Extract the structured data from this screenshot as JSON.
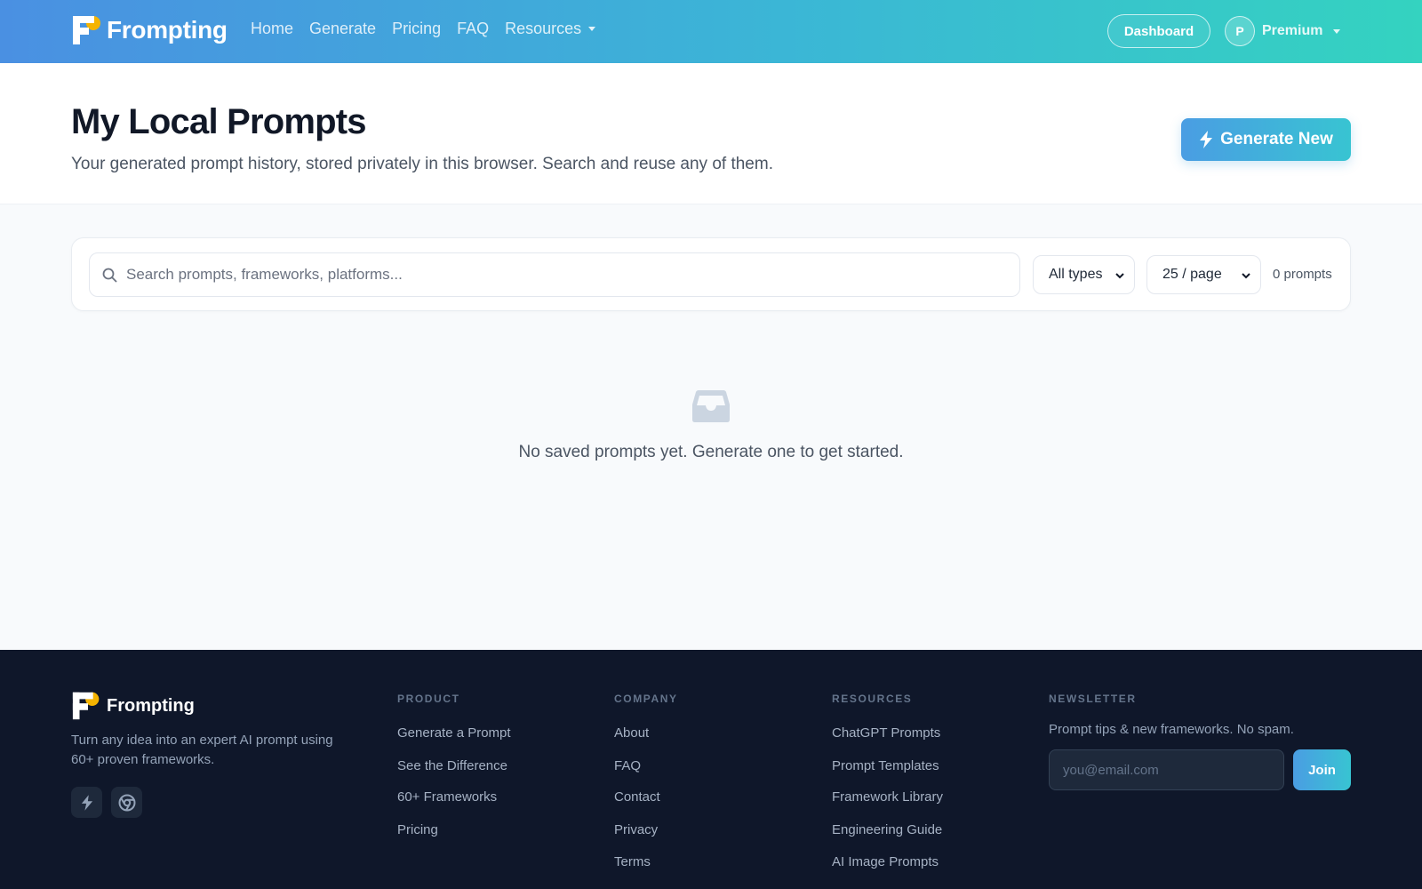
{
  "nav": {
    "brand": "Frompting",
    "links": [
      "Home",
      "Generate",
      "Pricing",
      "FAQ",
      "Resources"
    ],
    "dashboard_label": "Dashboard",
    "avatar_initial": "P",
    "account_label": "Premium"
  },
  "header": {
    "title": "My Local Prompts",
    "subtitle": "Your generated prompt history, stored privately in this browser. Search and reuse any of them.",
    "generate_label": "Generate New"
  },
  "filters": {
    "search_placeholder": "Search prompts, frameworks, platforms...",
    "type_value": "All types",
    "page_size_value": "25 / page",
    "count_text": "0 prompts"
  },
  "empty_state": {
    "icon": "inbox-icon",
    "message": "No saved prompts yet. Generate one to get started."
  },
  "footer": {
    "brand": "Frompting",
    "tagline": "Turn any idea into an expert AI prompt using 60+ proven frameworks.",
    "social_icons": [
      "bolt-icon",
      "chrome-icon"
    ],
    "product": {
      "heading": "PRODUCT",
      "items": [
        "Generate a Prompt",
        "See the Difference",
        "60+ Frameworks",
        "Pricing"
      ]
    },
    "company": {
      "heading": "COMPANY",
      "items": [
        "About",
        "FAQ",
        "Contact",
        "Privacy",
        "Terms"
      ]
    },
    "resources": {
      "heading": "RESOURCES",
      "items": [
        "ChatGPT Prompts",
        "Prompt Templates",
        "Framework Library",
        "Engineering Guide",
        "AI Image Prompts"
      ]
    },
    "newsletter": {
      "heading": "NEWSLETTER",
      "text": "Prompt tips & new frameworks. No spam.",
      "email_placeholder": "you@email.com",
      "join_label": "Join"
    }
  },
  "colors": {
    "nav_gradient_start": "#4a90e2",
    "nav_gradient_end": "#34d3c0",
    "footer_bg": "#0f172a",
    "accent": "#3bb6d6",
    "logo_dot": "#f5b400"
  }
}
